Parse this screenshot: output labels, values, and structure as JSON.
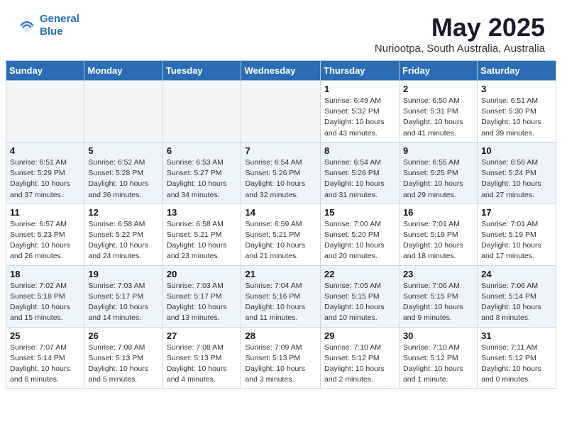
{
  "header": {
    "logo_line1": "General",
    "logo_line2": "Blue",
    "month_title": "May 2025",
    "subtitle": "Nuriootpa, South Australia, Australia"
  },
  "days_of_week": [
    "Sunday",
    "Monday",
    "Tuesday",
    "Wednesday",
    "Thursday",
    "Friday",
    "Saturday"
  ],
  "weeks": [
    [
      {
        "day": "",
        "info": ""
      },
      {
        "day": "",
        "info": ""
      },
      {
        "day": "",
        "info": ""
      },
      {
        "day": "",
        "info": ""
      },
      {
        "day": "1",
        "info": "Sunrise: 6:49 AM\nSunset: 5:32 PM\nDaylight: 10 hours\nand 43 minutes."
      },
      {
        "day": "2",
        "info": "Sunrise: 6:50 AM\nSunset: 5:31 PM\nDaylight: 10 hours\nand 41 minutes."
      },
      {
        "day": "3",
        "info": "Sunrise: 6:51 AM\nSunset: 5:30 PM\nDaylight: 10 hours\nand 39 minutes."
      }
    ],
    [
      {
        "day": "4",
        "info": "Sunrise: 6:51 AM\nSunset: 5:29 PM\nDaylight: 10 hours\nand 37 minutes."
      },
      {
        "day": "5",
        "info": "Sunrise: 6:52 AM\nSunset: 5:28 PM\nDaylight: 10 hours\nand 36 minutes."
      },
      {
        "day": "6",
        "info": "Sunrise: 6:53 AM\nSunset: 5:27 PM\nDaylight: 10 hours\nand 34 minutes."
      },
      {
        "day": "7",
        "info": "Sunrise: 6:54 AM\nSunset: 5:26 PM\nDaylight: 10 hours\nand 32 minutes."
      },
      {
        "day": "8",
        "info": "Sunrise: 6:54 AM\nSunset: 5:26 PM\nDaylight: 10 hours\nand 31 minutes."
      },
      {
        "day": "9",
        "info": "Sunrise: 6:55 AM\nSunset: 5:25 PM\nDaylight: 10 hours\nand 29 minutes."
      },
      {
        "day": "10",
        "info": "Sunrise: 6:56 AM\nSunset: 5:24 PM\nDaylight: 10 hours\nand 27 minutes."
      }
    ],
    [
      {
        "day": "11",
        "info": "Sunrise: 6:57 AM\nSunset: 5:23 PM\nDaylight: 10 hours\nand 26 minutes."
      },
      {
        "day": "12",
        "info": "Sunrise: 6:58 AM\nSunset: 5:22 PM\nDaylight: 10 hours\nand 24 minutes."
      },
      {
        "day": "13",
        "info": "Sunrise: 6:58 AM\nSunset: 5:21 PM\nDaylight: 10 hours\nand 23 minutes."
      },
      {
        "day": "14",
        "info": "Sunrise: 6:59 AM\nSunset: 5:21 PM\nDaylight: 10 hours\nand 21 minutes."
      },
      {
        "day": "15",
        "info": "Sunrise: 7:00 AM\nSunset: 5:20 PM\nDaylight: 10 hours\nand 20 minutes."
      },
      {
        "day": "16",
        "info": "Sunrise: 7:01 AM\nSunset: 5:19 PM\nDaylight: 10 hours\nand 18 minutes."
      },
      {
        "day": "17",
        "info": "Sunrise: 7:01 AM\nSunset: 5:19 PM\nDaylight: 10 hours\nand 17 minutes."
      }
    ],
    [
      {
        "day": "18",
        "info": "Sunrise: 7:02 AM\nSunset: 5:18 PM\nDaylight: 10 hours\nand 15 minutes."
      },
      {
        "day": "19",
        "info": "Sunrise: 7:03 AM\nSunset: 5:17 PM\nDaylight: 10 hours\nand 14 minutes."
      },
      {
        "day": "20",
        "info": "Sunrise: 7:03 AM\nSunset: 5:17 PM\nDaylight: 10 hours\nand 13 minutes."
      },
      {
        "day": "21",
        "info": "Sunrise: 7:04 AM\nSunset: 5:16 PM\nDaylight: 10 hours\nand 11 minutes."
      },
      {
        "day": "22",
        "info": "Sunrise: 7:05 AM\nSunset: 5:15 PM\nDaylight: 10 hours\nand 10 minutes."
      },
      {
        "day": "23",
        "info": "Sunrise: 7:06 AM\nSunset: 5:15 PM\nDaylight: 10 hours\nand 9 minutes."
      },
      {
        "day": "24",
        "info": "Sunrise: 7:06 AM\nSunset: 5:14 PM\nDaylight: 10 hours\nand 8 minutes."
      }
    ],
    [
      {
        "day": "25",
        "info": "Sunrise: 7:07 AM\nSunset: 5:14 PM\nDaylight: 10 hours\nand 6 minutes."
      },
      {
        "day": "26",
        "info": "Sunrise: 7:08 AM\nSunset: 5:13 PM\nDaylight: 10 hours\nand 5 minutes."
      },
      {
        "day": "27",
        "info": "Sunrise: 7:08 AM\nSunset: 5:13 PM\nDaylight: 10 hours\nand 4 minutes."
      },
      {
        "day": "28",
        "info": "Sunrise: 7:09 AM\nSunset: 5:13 PM\nDaylight: 10 hours\nand 3 minutes."
      },
      {
        "day": "29",
        "info": "Sunrise: 7:10 AM\nSunset: 5:12 PM\nDaylight: 10 hours\nand 2 minutes."
      },
      {
        "day": "30",
        "info": "Sunrise: 7:10 AM\nSunset: 5:12 PM\nDaylight: 10 hours\nand 1 minute."
      },
      {
        "day": "31",
        "info": "Sunrise: 7:11 AM\nSunset: 5:12 PM\nDaylight: 10 hours\nand 0 minutes."
      }
    ]
  ]
}
